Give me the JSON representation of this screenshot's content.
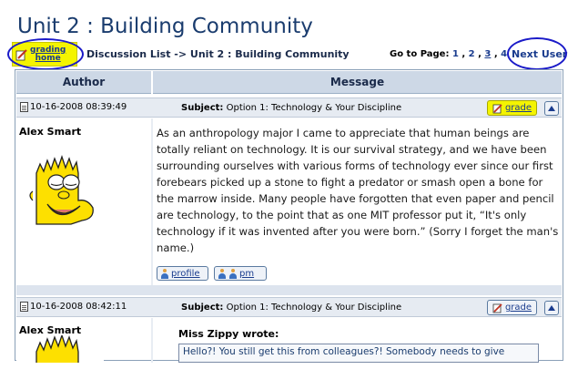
{
  "page_title": "Unit 2 : Building Community",
  "grading_home": {
    "line1": "grading",
    "line2": "home"
  },
  "breadcrumb": "Discussion List -> Unit 2 : Building Community",
  "go_to_page": {
    "label": "Go to Page:",
    "pages": [
      "1",
      "2",
      "3",
      "4"
    ]
  },
  "next_user": "Next User",
  "table_headers": {
    "author": "Author",
    "message": "Message"
  },
  "posts": [
    {
      "date": "10-16-2008 08:39:49",
      "subject_label": "Subject:",
      "subject": "Option 1: Technology & Your Discipline",
      "grade_label": "grade",
      "author": "Alex Smart",
      "avatar_icon": "bart-simpson-avatar-icon",
      "body": "As an anthropology major I came to appreciate that human beings are totally reliant on technology. It is our survival strategy, and we have been surrounding ourselves with various forms of technology ever since our first forebears picked up a stone to fight a predator or smash open a bone for the marrow inside. Many people have forgotten that even paper and pencil are technology, to the point that as one MIT professor put it, “It's only technology if it was invented after you were born.” (Sorry I forget the man's name.)",
      "profile_label": "profile",
      "pm_label": "pm"
    },
    {
      "date": "10-16-2008 08:42:11",
      "subject_label": "Subject:",
      "subject": "Option 1: Technology & Your Discipline",
      "grade_label": "grade",
      "author": "Alex Smart",
      "avatar_icon": "bart-simpson-avatar-icon",
      "quote_header": "Miss Zippy wrote:",
      "quote_text": "Hello?! You still get this from colleagues?! Somebody needs to give"
    }
  ],
  "colors": {
    "highlight": "#f4f400",
    "annotation_circle": "#1a1ac8",
    "header_bg": "#cdd8e6",
    "title": "#1a3c6e"
  }
}
